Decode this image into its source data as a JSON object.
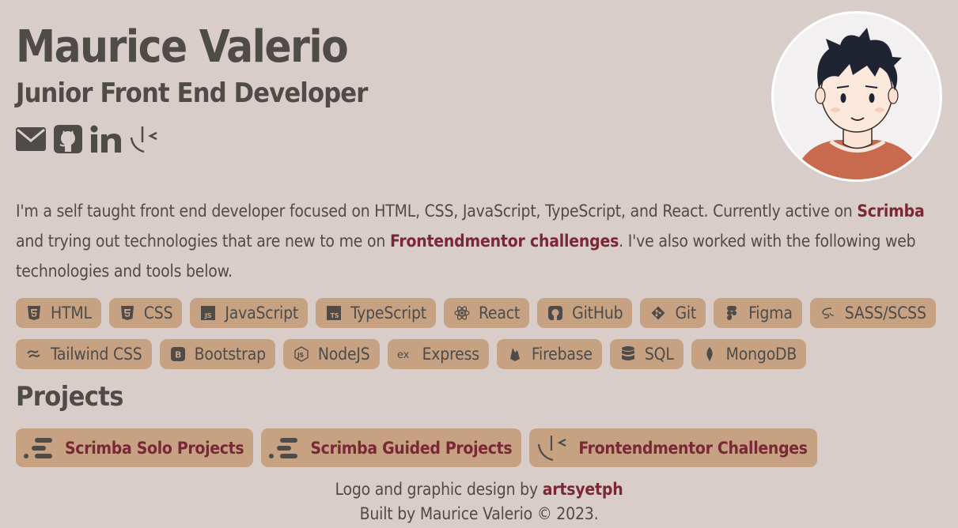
{
  "header": {
    "name": "Maurice Valerio",
    "role": "Junior Front End Developer"
  },
  "socials": [
    {
      "label": "Email",
      "icon": "mail-icon"
    },
    {
      "label": "GitHub",
      "icon": "github-icon"
    },
    {
      "label": "LinkedIn",
      "icon": "linkedin-icon"
    },
    {
      "label": "Frontend Mentor",
      "icon": "frontendmentor-icon"
    }
  ],
  "intro": {
    "part1": "I'm a self taught front end developer focused on HTML, CSS, JavaScript, TypeScript, and React. Currently active on ",
    "link1": "Scrimba",
    "part2": " and trying out technologies that are new to me on ",
    "link2": "Frontendmentor challenges",
    "part3": ". I've also worked with the following web technologies and tools below."
  },
  "tags_row1": [
    "HTML",
    "CSS",
    "JavaScript",
    "TypeScript",
    "React",
    "GitHub",
    "Git",
    "Figma",
    "SASS/SCSS"
  ],
  "tags_row2": [
    "Tailwind CSS",
    "Bootstrap",
    "NodeJS",
    "Express",
    "Firebase",
    "SQL",
    "MongoDB"
  ],
  "projects": {
    "title": "Projects",
    "items": [
      "Scrimba Solo Projects",
      "Scrimba Guided Projects",
      "Frontendmentor Challenges"
    ]
  },
  "footer": {
    "line1_prefix": "Logo and graphic design by ",
    "line1_link": "artsyetph",
    "line2": "Built by Maurice Valerio © 2023."
  },
  "colors": {
    "background": "#d8cdc8",
    "text": "#4f4b49",
    "accent": "#7a2838",
    "tag_background": "#c6a282"
  }
}
